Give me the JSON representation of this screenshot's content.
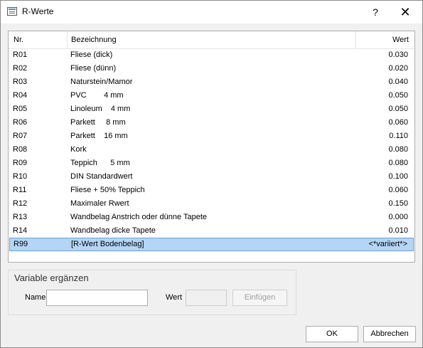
{
  "window": {
    "title": "R-Werte",
    "help": "?",
    "close": "✕"
  },
  "list": {
    "headers": {
      "nr": "Nr.",
      "bezeichnung": "Bezeichnung",
      "wert": "Wert"
    },
    "rows": [
      {
        "nr": "R01",
        "bezeichnung": "Fliese (dick)",
        "wert": "0.030"
      },
      {
        "nr": "R02",
        "bezeichnung": "Fliese (dünn)",
        "wert": "0.020"
      },
      {
        "nr": "R03",
        "bezeichnung": "Naturstein/Mamor",
        "wert": "0.040"
      },
      {
        "nr": "R04",
        "bezeichnung": "PVC        4 mm",
        "wert": "0.050"
      },
      {
        "nr": "R05",
        "bezeichnung": "Linoleum    4 mm",
        "wert": "0.050"
      },
      {
        "nr": "R06",
        "bezeichnung": "Parkett     8 mm",
        "wert": "0.060"
      },
      {
        "nr": "R07",
        "bezeichnung": "Parkett    16 mm",
        "wert": "0.110"
      },
      {
        "nr": "R08",
        "bezeichnung": "Kork",
        "wert": "0.080"
      },
      {
        "nr": "R09",
        "bezeichnung": "Teppich      5 mm",
        "wert": "0.080"
      },
      {
        "nr": "R10",
        "bezeichnung": "DIN Standardwert",
        "wert": "0.100"
      },
      {
        "nr": "R11",
        "bezeichnung": "Fliese + 50% Teppich",
        "wert": "0.060"
      },
      {
        "nr": "R12",
        "bezeichnung": "Maximaler Rwert",
        "wert": "0.150"
      },
      {
        "nr": "R13",
        "bezeichnung": "Wandbelag Anstrich oder dünne Tapete",
        "wert": "0.000"
      },
      {
        "nr": "R14",
        "bezeichnung": "Wandbelag dicke Tapete",
        "wert": "0.010"
      },
      {
        "nr": "R99",
        "bezeichnung": "[R-Wert Bodenbelag]",
        "wert": "<*variiert*>",
        "selected": true
      }
    ]
  },
  "variable_group": {
    "title": "Variable ergänzen",
    "name_label": "Name",
    "name_value": "",
    "wert_label": "Wert",
    "wert_value": "",
    "insert_label": "Einfügen"
  },
  "buttons": {
    "ok": "OK",
    "cancel": "Abbrechen"
  },
  "colors": {
    "selection_bg": "#b5d5f5",
    "selection_border": "#6b9fd6",
    "dialog_bg": "#f0f0f0"
  }
}
